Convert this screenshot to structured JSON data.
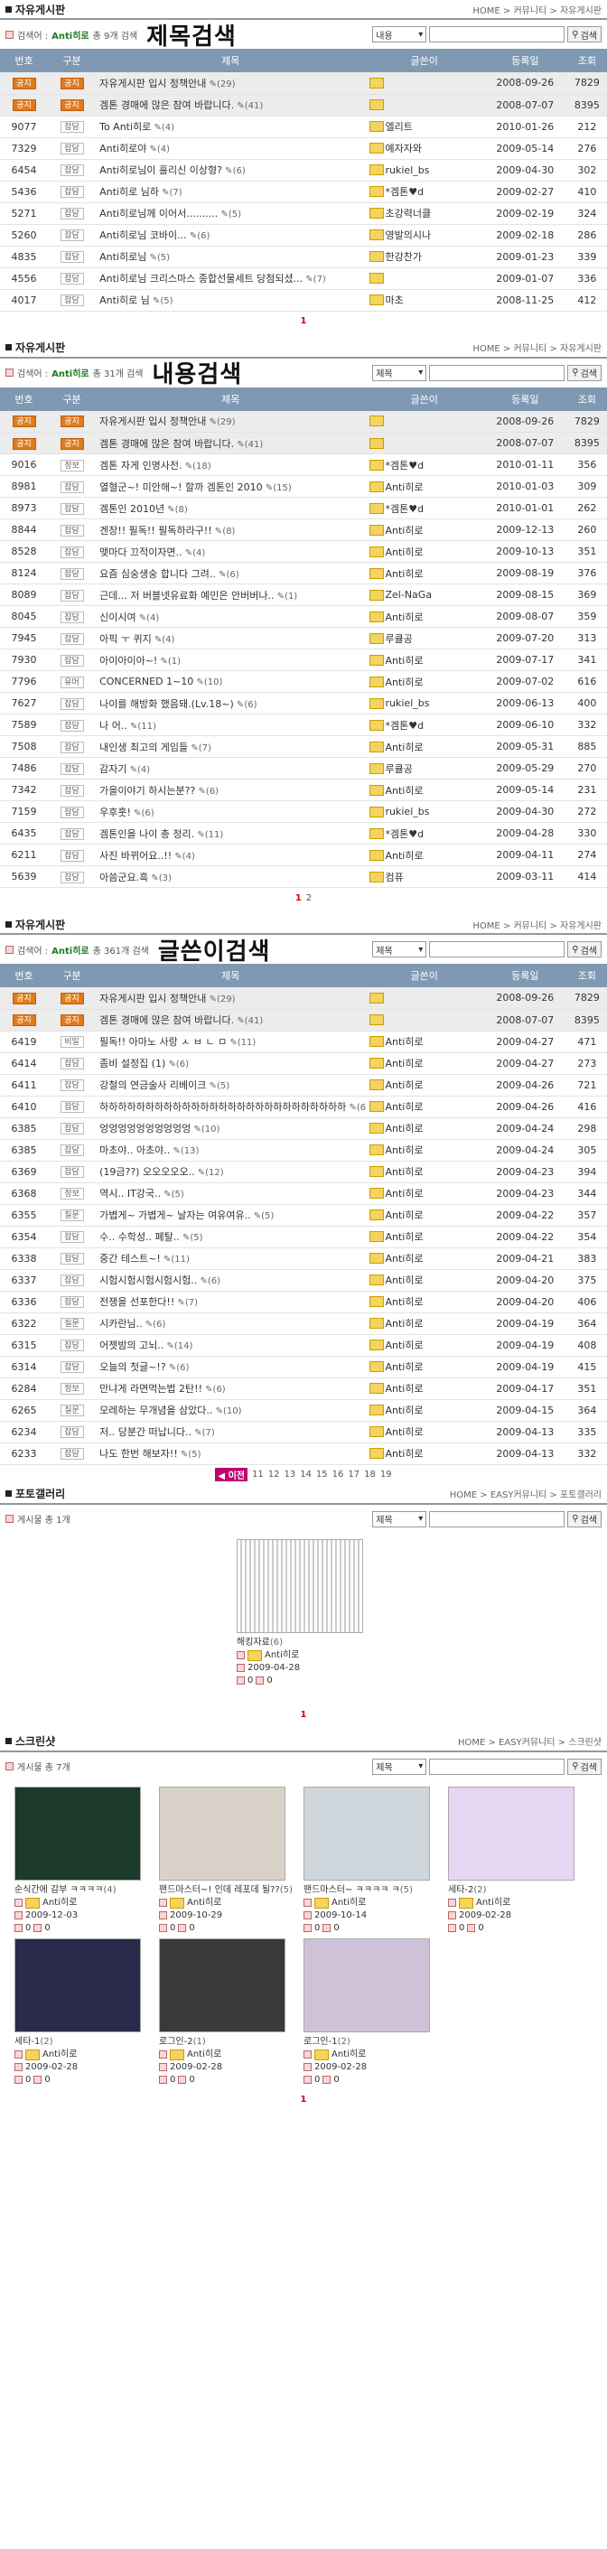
{
  "notice_label": "공지",
  "colors": {
    "header": "#7f99b3",
    "accent": "#1a7a1a",
    "notice_badge": "#e07a1a",
    "page_current": "#dd0000"
  },
  "s1": {
    "title": "자유게시판",
    "breadcrumb": "HOME > 커뮤니티 > 자유게시판",
    "search_prefix": "검색어 :",
    "keyword": "Anti히로",
    "count": "총 9개 검색",
    "big": "제목검색",
    "select": "내용",
    "search_btn": "검색",
    "cols": [
      "번호",
      "구분",
      "제목",
      "글쓴이",
      "등록일",
      "조회"
    ],
    "rows": [
      {
        "no": "",
        "cat": "",
        "title": "자유게시판 입시 정책안내",
        "cm": "(29)",
        "writer": "",
        "date": "2008-09-26",
        "views": "7829"
      },
      {
        "no": "",
        "cat": "",
        "title": "겜톤 경매에 많은 참여 바랍니다.",
        "cm": "(41)",
        "writer": "",
        "date": "2008-07-07",
        "views": "8395"
      },
      {
        "no": "9077",
        "cat": "잡담",
        "title": "To Anti히로",
        "cm": "(4)",
        "writer": "엘리트",
        "date": "2010-01-26",
        "views": "212"
      },
      {
        "no": "7329",
        "cat": "잡담",
        "title": "Anti히로야",
        "cm": "(4)",
        "writer": "예자자와",
        "date": "2009-05-14",
        "views": "276"
      },
      {
        "no": "6454",
        "cat": "잡담",
        "title": "Anti히로님이 흘리신 이상형?",
        "cm": "(6)",
        "writer": "rukiel_bs",
        "date": "2009-04-30",
        "views": "302"
      },
      {
        "no": "5436",
        "cat": "잡담",
        "title": "Anti히로 님하",
        "cm": "(7)",
        "writer": "*겜톤♥d",
        "date": "2009-02-27",
        "views": "410"
      },
      {
        "no": "5271",
        "cat": "잡담",
        "title": "Anti히로님께 이어서..........",
        "cm": "(5)",
        "writer": "초강력너클",
        "date": "2009-02-19",
        "views": "324"
      },
      {
        "no": "5260",
        "cat": "잡담",
        "title": "Anti히로님 코바이...",
        "cm": "(6)",
        "writer": "영발의시나",
        "date": "2009-02-18",
        "views": "286"
      },
      {
        "no": "4835",
        "cat": "잡담",
        "title": "Anti히로님",
        "cm": "(5)",
        "writer": "한강찬가",
        "date": "2009-01-23",
        "views": "339"
      },
      {
        "no": "4556",
        "cat": "잡담",
        "title": "Anti히로님 크리스마스 종합선물세트 당첨되셨...",
        "cm": "(7)",
        "writer": "",
        "date": "2009-01-07",
        "views": "336"
      },
      {
        "no": "4017",
        "cat": "잡담",
        "title": "Anti히로 님",
        "cm": "(5)",
        "writer": "마초",
        "date": "2008-11-25",
        "views": "412"
      }
    ],
    "pages": [
      "1"
    ]
  },
  "s2": {
    "title": "자유게시판",
    "breadcrumb": "HOME > 커뮤니티 > 자유게시판",
    "search_prefix": "검색어 :",
    "keyword": "Anti히로",
    "count": "총 31개 검색",
    "big": "내용검색",
    "select": "제목",
    "search_btn": "검색",
    "cols": [
      "번호",
      "구분",
      "제목",
      "글쓴이",
      "등록일",
      "조회"
    ],
    "rows": [
      {
        "no": "",
        "cat": "",
        "title": "자유게시판 입시 정책안내",
        "cm": "(29)",
        "writer": "",
        "date": "2008-09-26",
        "views": "7829"
      },
      {
        "no": "",
        "cat": "",
        "title": "겜톤 경매에 많은 참여 바랍니다.",
        "cm": "(41)",
        "writer": "",
        "date": "2008-07-07",
        "views": "8395"
      },
      {
        "no": "9016",
        "cat": "정보",
        "title": "겜톤 자게 인명사전.",
        "cm": "(18)",
        "writer": "*겜톤♥d",
        "date": "2010-01-11",
        "views": "356"
      },
      {
        "no": "8981",
        "cat": "잡담",
        "title": "열혈군~! 미안해~! 할까 겜톤인 2010",
        "cm": "(15)",
        "writer": "Anti히로",
        "date": "2010-01-03",
        "views": "309"
      },
      {
        "no": "8973",
        "cat": "잡담",
        "title": "겜톤인 2010년",
        "cm": "(8)",
        "writer": "*겜톤♥d",
        "date": "2010-01-01",
        "views": "262"
      },
      {
        "no": "8844",
        "cat": "잡담",
        "title": "겐장!! 필독!! 필독하라구!!",
        "cm": "(8)",
        "writer": "Anti히로",
        "date": "2009-12-13",
        "views": "260"
      },
      {
        "no": "8528",
        "cat": "잡담",
        "title": "맺마다 끄적이자면..",
        "cm": "(4)",
        "writer": "Anti히로",
        "date": "2009-10-13",
        "views": "351"
      },
      {
        "no": "8124",
        "cat": "잡담",
        "title": "요즘 심숭생숭 합니다 그려..",
        "cm": "(6)",
        "writer": "Anti히로",
        "date": "2009-08-19",
        "views": "376"
      },
      {
        "no": "8089",
        "cat": "잡담",
        "title": "근데... 저 버블넷유료화 예민은 안버버나..",
        "cm": "(1)",
        "writer": "Zel-NaGa",
        "date": "2009-08-15",
        "views": "369"
      },
      {
        "no": "8045",
        "cat": "잡담",
        "title": "신이시여",
        "cm": "(4)",
        "writer": "Anti히로",
        "date": "2009-08-07",
        "views": "359"
      },
      {
        "no": "7945",
        "cat": "잡담",
        "title": "아픽 ㅜ 퀴지",
        "cm": "(4)",
        "writer": "루큘공",
        "date": "2009-07-20",
        "views": "313"
      },
      {
        "no": "7930",
        "cat": "잡담",
        "title": "아이아이아~!",
        "cm": "(1)",
        "writer": "Anti히로",
        "date": "2009-07-17",
        "views": "341"
      },
      {
        "no": "7796",
        "cat": "유머",
        "title": "CONCERNED 1~10",
        "cm": "(10)",
        "writer": "Anti히로",
        "date": "2009-07-02",
        "views": "616"
      },
      {
        "no": "7627",
        "cat": "잡담",
        "title": "나이를 해방화 했음돼.(Lv.18~)",
        "cm": "(6)",
        "writer": "rukiel_bs",
        "date": "2009-06-13",
        "views": "400"
      },
      {
        "no": "7589",
        "cat": "잡담",
        "title": "나 어..",
        "cm": "(11)",
        "writer": "*겜톤♥d",
        "date": "2009-06-10",
        "views": "332"
      },
      {
        "no": "7508",
        "cat": "잡담",
        "title": "내인생 최고의 게임들",
        "cm": "(7)",
        "writer": "Anti히로",
        "date": "2009-05-31",
        "views": "885"
      },
      {
        "no": "7486",
        "cat": "잡담",
        "title": "감자기",
        "cm": "(4)",
        "writer": "루큘공",
        "date": "2009-05-29",
        "views": "270"
      },
      {
        "no": "7342",
        "cat": "잡담",
        "title": "가을이야기 하시는분??",
        "cm": "(6)",
        "writer": "Anti히로",
        "date": "2009-05-14",
        "views": "231"
      },
      {
        "no": "7159",
        "cat": "잡담",
        "title": "우후훗!",
        "cm": "(6)",
        "writer": "rukiel_bs",
        "date": "2009-04-30",
        "views": "272"
      },
      {
        "no": "6435",
        "cat": "잡담",
        "title": "겜톤인을 나이 총 정리.",
        "cm": "(11)",
        "writer": "*겜톤♥d",
        "date": "2009-04-28",
        "views": "330"
      },
      {
        "no": "6211",
        "cat": "잡담",
        "title": "사진 바뀌어요..!!",
        "cm": "(4)",
        "writer": "Anti히로",
        "date": "2009-04-11",
        "views": "274"
      },
      {
        "no": "5639",
        "cat": "잡담",
        "title": "아씀군요.흑",
        "cm": "(3)",
        "writer": "컴퓨",
        "date": "2009-03-11",
        "views": "414"
      }
    ],
    "pages": [
      "1",
      "2"
    ]
  },
  "s3": {
    "title": "자유게시판",
    "breadcrumb": "HOME > 커뮤니티 > 자유게시판",
    "search_prefix": "검색어 :",
    "keyword": "Anti히로",
    "count": "총 361개 검색",
    "big": "글쓴이검색",
    "select": "제목",
    "search_btn": "검색",
    "cols": [
      "번호",
      "구분",
      "제목",
      "글쓴이",
      "등록일",
      "조회"
    ],
    "rows": [
      {
        "no": "",
        "cat": "",
        "title": "자유게시판 입시 정책안내",
        "cm": "(29)",
        "writer": "",
        "date": "2008-09-26",
        "views": "7829"
      },
      {
        "no": "",
        "cat": "",
        "title": "겜톤 경매에 많은 참여 바랍니다.",
        "cm": "(41)",
        "writer": "",
        "date": "2008-07-07",
        "views": "8395"
      },
      {
        "no": "6419",
        "cat": "비밀",
        "title": "필독!! 아마노 사랑 ㅅ ㅂ ㄴ ㅁ",
        "cm": "(11)",
        "writer": "Anti히로",
        "date": "2009-04-27",
        "views": "471"
      },
      {
        "no": "6414",
        "cat": "잡담",
        "title": "좀비 설정집 (1)",
        "cm": "(6)",
        "writer": "Anti히로",
        "date": "2009-04-27",
        "views": "273"
      },
      {
        "no": "6411",
        "cat": "잡담",
        "title": "강철의 연금술사 리베이크",
        "cm": "(5)",
        "writer": "Anti히로",
        "date": "2009-04-26",
        "views": "721"
      },
      {
        "no": "6410",
        "cat": "잡담",
        "title": "하하하하하하하하하하하하하하하하하하하하하하하하하하하",
        "cm": "(6)",
        "writer": "Anti히로",
        "date": "2009-04-26",
        "views": "416"
      },
      {
        "no": "6385",
        "cat": "잡담",
        "title": "엉엉엉엉엉엉엉엉엉엉",
        "cm": "(10)",
        "writer": "Anti히로",
        "date": "2009-04-24",
        "views": "298"
      },
      {
        "no": "6385",
        "cat": "잡담",
        "title": "마초야.. 아초야..",
        "cm": "(13)",
        "writer": "Anti히로",
        "date": "2009-04-24",
        "views": "305"
      },
      {
        "no": "6369",
        "cat": "잡담",
        "title": "(19금??) 오오오오오..",
        "cm": "(12)",
        "writer": "Anti히로",
        "date": "2009-04-23",
        "views": "394"
      },
      {
        "no": "6368",
        "cat": "정보",
        "title": "역시.. IT강국..",
        "cm": "(5)",
        "writer": "Anti히로",
        "date": "2009-04-23",
        "views": "344"
      },
      {
        "no": "6355",
        "cat": "질문",
        "title": "가볍게~ 가볍게~ 날자는 여유여유..",
        "cm": "(5)",
        "writer": "Anti히로",
        "date": "2009-04-22",
        "views": "357"
      },
      {
        "no": "6354",
        "cat": "잡담",
        "title": "수.. 수학성.. 폐탈..",
        "cm": "(5)",
        "writer": "Anti히로",
        "date": "2009-04-22",
        "views": "354"
      },
      {
        "no": "6338",
        "cat": "잡담",
        "title": "중간 테스트~!",
        "cm": "(11)",
        "writer": "Anti히로",
        "date": "2009-04-21",
        "views": "383"
      },
      {
        "no": "6337",
        "cat": "잡담",
        "title": "시험시험시험시험시험..",
        "cm": "(6)",
        "writer": "Anti히로",
        "date": "2009-04-20",
        "views": "375"
      },
      {
        "no": "6336",
        "cat": "잡담",
        "title": "전쟁을 선포한다!!",
        "cm": "(7)",
        "writer": "Anti히로",
        "date": "2009-04-20",
        "views": "406"
      },
      {
        "no": "6322",
        "cat": "질문",
        "title": "시카란님..",
        "cm": "(6)",
        "writer": "Anti히로",
        "date": "2009-04-19",
        "views": "364"
      },
      {
        "no": "6315",
        "cat": "잡담",
        "title": "어젯밤의 고뇌..",
        "cm": "(14)",
        "writer": "Anti히로",
        "date": "2009-04-19",
        "views": "408"
      },
      {
        "no": "6314",
        "cat": "잡담",
        "title": "오늘의 첫글~!?",
        "cm": "(6)",
        "writer": "Anti히로",
        "date": "2009-04-19",
        "views": "415"
      },
      {
        "no": "6284",
        "cat": "정보",
        "title": "만냐게 라면먹는법 2탄!!",
        "cm": "(6)",
        "writer": "Anti히로",
        "date": "2009-04-17",
        "views": "351"
      },
      {
        "no": "6265",
        "cat": "질문",
        "title": "모레하는 무개념을 삼았다..",
        "cm": "(10)",
        "writer": "Anti히로",
        "date": "2009-04-15",
        "views": "364"
      },
      {
        "no": "6234",
        "cat": "잡담",
        "title": "저.. 당분간 떠납니다..",
        "cm": "(7)",
        "writer": "Anti히로",
        "date": "2009-04-13",
        "views": "335"
      },
      {
        "no": "6233",
        "cat": "잡담",
        "title": "나도 한번 해보자!!",
        "cm": "(5)",
        "writer": "Anti히로",
        "date": "2009-04-13",
        "views": "332"
      }
    ],
    "prev": "◀ 이전",
    "pages": [
      "11",
      "12",
      "13",
      "14",
      "15",
      "16",
      "17",
      "18",
      "19"
    ]
  },
  "s4": {
    "title": "포토갤러리",
    "breadcrumb": "HOME > EASY커뮤니티 > 포토갤러리",
    "count": "게시물 총 1개",
    "select": "제목",
    "search_btn": "검색",
    "cards": [
      {
        "title": "해킹자료",
        "cm": "(6)",
        "writer": "Anti히로",
        "date": "2009-04-28",
        "a": "0",
        "b": "0"
      }
    ],
    "pages": [
      "1"
    ]
  },
  "s5": {
    "title": "스크린샷",
    "breadcrumb": "HOME > EASY커뮤니티 > 스크린샷",
    "count": "게시물 총 7개",
    "select": "제목",
    "search_btn": "검색",
    "cards": [
      {
        "title": "순식간에 감부 ㅋㅋㅋㅋ",
        "cm": "(4)",
        "writer": "Anti히로",
        "date": "2009-12-03",
        "a": "0",
        "b": "0"
      },
      {
        "title": "팬드마스터~! 인데 레포데 될??",
        "cm": "(5)",
        "writer": "Anti히로",
        "date": "2009-10-29",
        "a": "0",
        "b": "0"
      },
      {
        "title": "팬드마스터~ ㅋㅋㅋㅋ ㅋ",
        "cm": "(5)",
        "writer": "Anti히로",
        "date": "2009-10-14",
        "a": "0",
        "b": "0"
      },
      {
        "title": "세타-2",
        "cm": "(2)",
        "writer": "Anti히로",
        "date": "2009-02-28",
        "a": "0",
        "b": "0"
      },
      {
        "title": "세타-1",
        "cm": "(2)",
        "writer": "Anti히로",
        "date": "2009-02-28",
        "a": "0",
        "b": "0"
      },
      {
        "title": "로그인-2",
        "cm": "(1)",
        "writer": "Anti히로",
        "date": "2009-02-28",
        "a": "0",
        "b": "0"
      },
      {
        "title": "로그인-1",
        "cm": "(2)",
        "writer": "Anti히로",
        "date": "2009-02-28",
        "a": "0",
        "b": "0"
      }
    ],
    "pages": [
      "1"
    ]
  }
}
